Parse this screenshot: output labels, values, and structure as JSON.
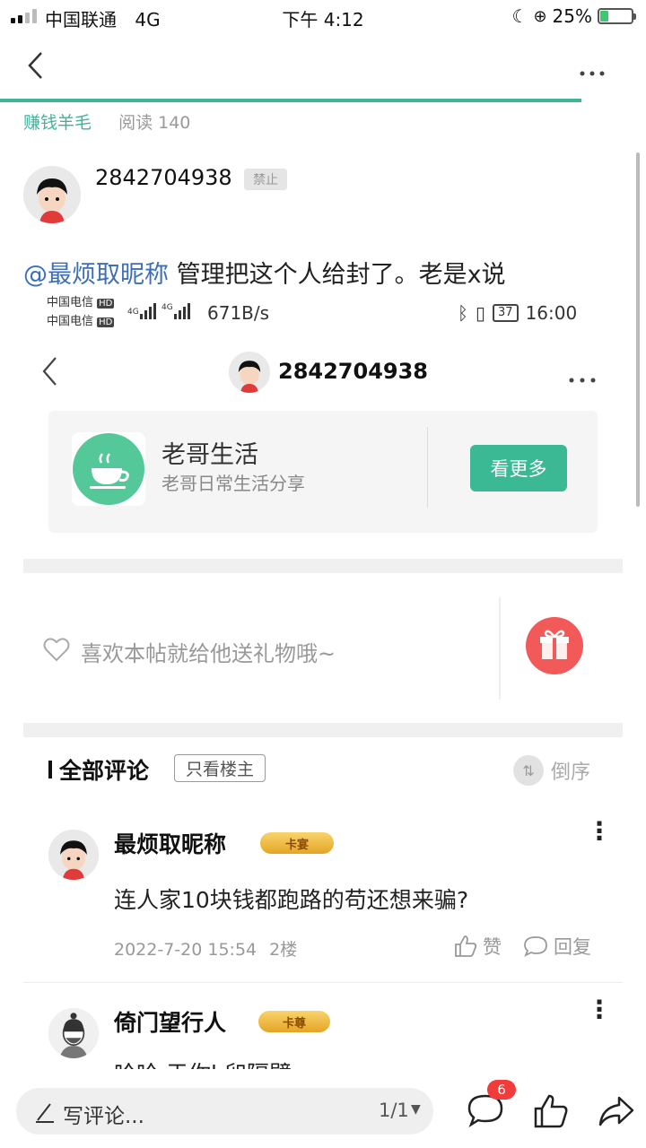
{
  "status_bar": {
    "carrier": "中国联通",
    "network": "4G",
    "time": "下午 4:12",
    "battery": "25%",
    "battery_level": 0.25,
    "icons": [
      "moon-icon",
      "rotation-lock-icon"
    ]
  },
  "nav": {
    "back": "back-chevron-icon",
    "more": "more-dots-icon"
  },
  "post": {
    "category": "赚钱羊毛",
    "views_label": "阅读 140",
    "author": "2842704938",
    "author_badge": "禁止",
    "mention": "@最烦取昵称",
    "content": " 管理把这个人给封了。老是x说"
  },
  "embedded": {
    "status": {
      "carrier1": "中国电信",
      "carrier2": "中国电信",
      "hd": "HD",
      "speed": "671B/s",
      "battery": "37",
      "time": "16:00"
    },
    "header_name": "2842704938",
    "card": {
      "title": "老哥生活",
      "subtitle": "老哥日常生活分享",
      "button": "看更多"
    },
    "gift_prompt": "喜欢本帖就给他送礼物哦~"
  },
  "comments": {
    "title": "全部评论",
    "only_op": "只看楼主",
    "sort_label": "倒序",
    "items": [
      {
        "name": "最烦取昵称",
        "badge": "卡宴",
        "text": "连人家10块钱都跑路的苟还想来骗?",
        "time": "2022-7-20 15:54",
        "floor": "2楼",
        "like": "赞",
        "reply": "回复"
      },
      {
        "name": "倚门望行人",
        "badge": "卡尊",
        "text": "哈哈 于你l 卯隔壁",
        "time": "",
        "floor": "",
        "like": "",
        "reply": ""
      }
    ]
  },
  "bottom_bar": {
    "placeholder": "写评论...",
    "page": "1/1",
    "notification_count": "6"
  },
  "colors": {
    "accent": "#3fb39a",
    "mention": "#3d6fb8",
    "gift": "#f25a5a",
    "badge_red": "#f23b3b"
  }
}
